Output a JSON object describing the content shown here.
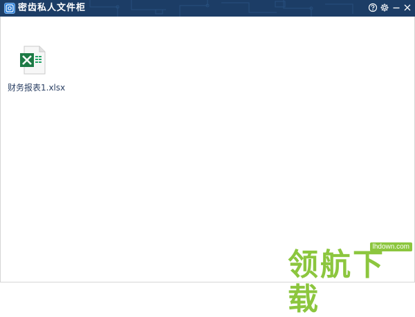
{
  "window": {
    "title": "密齿私人文件柜",
    "accent_color": "#1c3d66",
    "controls": [
      "help-icon",
      "settings-icon",
      "minimize-icon",
      "close-icon"
    ]
  },
  "files": [
    {
      "name": "财务报表1.xlsx",
      "icon": "excel-file-icon"
    }
  ],
  "watermark": {
    "text": "领航下载",
    "url": "lhdown.com",
    "color": "#8cc63e"
  }
}
